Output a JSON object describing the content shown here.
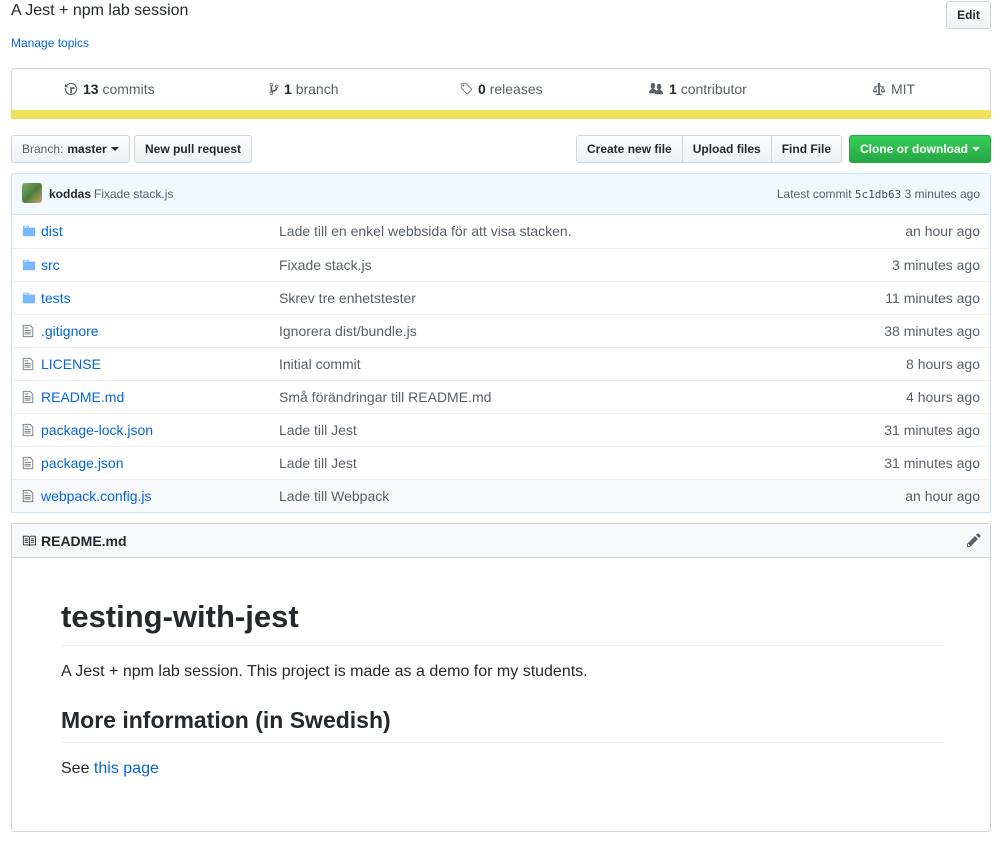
{
  "repo": {
    "description": "A Jest + npm lab session",
    "manage_topics": "Manage topics",
    "edit_label": "Edit"
  },
  "numbers": {
    "commits": {
      "count": "13",
      "label": "commits"
    },
    "branches": {
      "count": "1",
      "label": "branch"
    },
    "releases": {
      "count": "0",
      "label": "releases"
    },
    "contributors": {
      "count": "1",
      "label": "contributor"
    },
    "license": "MIT",
    "language_color": "#f1e05a"
  },
  "toolbar": {
    "branch_prefix": "Branch:",
    "branch_name": "master",
    "new_pull_request": "New pull request",
    "create_new_file": "Create new file",
    "upload_files": "Upload files",
    "find_file": "Find File",
    "clone_or_download": "Clone or download"
  },
  "latest_commit": {
    "author": "koddas",
    "message": "Fixade stack.js",
    "prefix": "Latest commit",
    "sha": "5c1db63",
    "age": "3 minutes ago"
  },
  "files": [
    {
      "type": "dir",
      "name": "dist",
      "message": "Lade till en enkel webbsida för att visa stacken.",
      "age": "an hour ago"
    },
    {
      "type": "dir",
      "name": "src",
      "message": "Fixade stack.js",
      "age": "3 minutes ago"
    },
    {
      "type": "dir",
      "name": "tests",
      "message": "Skrev tre enhetstester",
      "age": "11 minutes ago"
    },
    {
      "type": "file",
      "name": ".gitignore",
      "message": "Ignorera dist/bundle.js",
      "age": "38 minutes ago"
    },
    {
      "type": "file",
      "name": "LICENSE",
      "message": "Initial commit",
      "age": "8 hours ago"
    },
    {
      "type": "file",
      "name": "README.md",
      "message": "Små förändringar till README.md",
      "age": "4 hours ago"
    },
    {
      "type": "file",
      "name": "package-lock.json",
      "message": "Lade till Jest",
      "age": "31 minutes ago"
    },
    {
      "type": "file",
      "name": "package.json",
      "message": "Lade till Jest",
      "age": "31 minutes ago"
    },
    {
      "type": "file",
      "name": "webpack.config.js",
      "message": "Lade till Webpack",
      "age": "an hour ago"
    }
  ],
  "readme": {
    "filename": "README.md",
    "h1": "testing-with-jest",
    "intro": "A Jest + npm lab session. This project is made as a demo for my students.",
    "h2": "More information (in Swedish)",
    "see_prefix": "See ",
    "link_text": "this page"
  }
}
